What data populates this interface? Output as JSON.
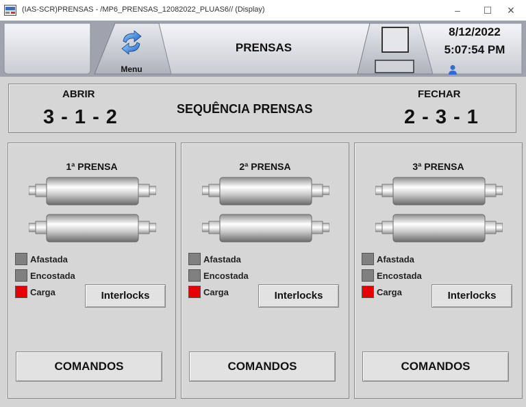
{
  "window": {
    "title": "(IAS-SCR)PRENSAS - /MP6_PRENSAS_12082022_PLUAS6// (Display)",
    "min_symbol": "–",
    "max_symbol": "☐",
    "close_symbol": "✕"
  },
  "header": {
    "menu_label": "Menu",
    "menu_icon": "refresh-arrows-icon",
    "title": "PRENSAS",
    "date": "8/12/2022",
    "time": "5:07:54 PM",
    "user_icon": "user-icon"
  },
  "sequence": {
    "title": "SEQUÊNCIA PRENSAS",
    "open_label": "ABRIR",
    "open_value": "3 - 1 - 2",
    "close_label": "FECHAR",
    "close_value": "2 - 3 - 1"
  },
  "presses": [
    {
      "title": "1ª PRENSA",
      "status": [
        {
          "label": "Afastada",
          "color": "#808080"
        },
        {
          "label": "Encostada",
          "color": "#808080"
        },
        {
          "label": "Carga",
          "color": "#e60000"
        }
      ],
      "interlocks_label": "Interlocks",
      "commands_label": "COMANDOS"
    },
    {
      "title": "2ª PRENSA",
      "status": [
        {
          "label": "Afastada",
          "color": "#808080"
        },
        {
          "label": "Encostada",
          "color": "#808080"
        },
        {
          "label": "Carga",
          "color": "#e60000"
        }
      ],
      "interlocks_label": "Interlocks",
      "commands_label": "COMANDOS"
    },
    {
      "title": "3ª PRENSA",
      "status": [
        {
          "label": "Afastada",
          "color": "#808080"
        },
        {
          "label": "Encostada",
          "color": "#808080"
        },
        {
          "label": "Carga",
          "color": "#e60000"
        }
      ],
      "interlocks_label": "Interlocks",
      "commands_label": "COMANDOS"
    }
  ],
  "colors": {
    "status_off": "#808080",
    "status_alarm": "#e60000",
    "panel_bg": "#d6d6d6",
    "header_bg": "#b8bcc4"
  }
}
